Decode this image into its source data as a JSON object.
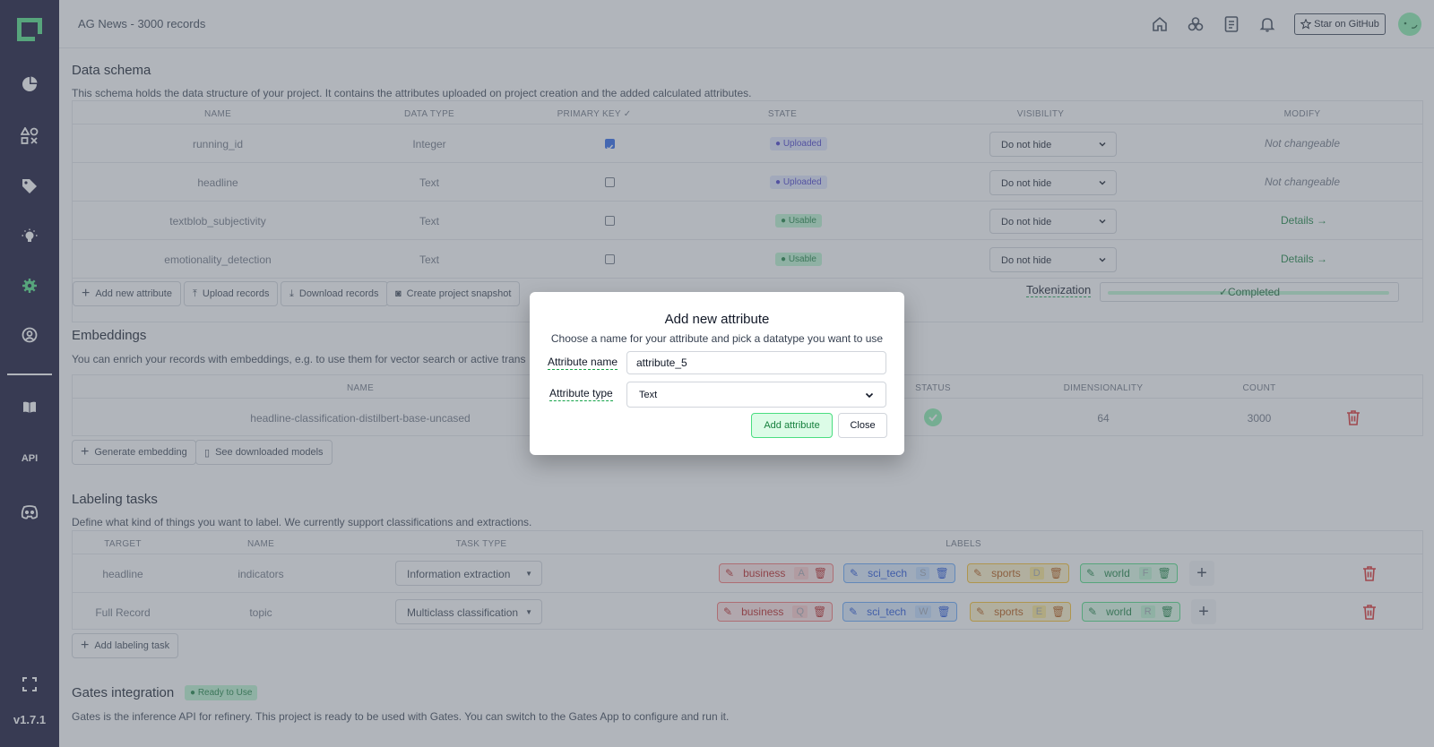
{
  "app": {
    "project_title": "AG News - 3000 records",
    "version": "v1.7.1",
    "github_label": "Star on GitHub",
    "accent_color": "#4ade80",
    "sidebar_bg": "#0c0a2e"
  },
  "sidebar": {
    "items": [
      {
        "icon": "overview-pie-icon"
      },
      {
        "icon": "data-browser-icon"
      },
      {
        "icon": "labeling-tag-icon"
      },
      {
        "icon": "heuristics-bulb-icon"
      },
      {
        "icon": "settings-gear-icon"
      },
      {
        "icon": "user-circle-icon"
      },
      {
        "icon": "docs-book-icon"
      },
      {
        "icon": "api-icon",
        "label": "API"
      },
      {
        "icon": "discord-icon"
      },
      {
        "icon": "fullscreen-icon"
      }
    ]
  },
  "topbar": {
    "icons": [
      "home-icon",
      "community-icon",
      "docs-icon",
      "bell-icon"
    ]
  },
  "data_schema": {
    "title": "Data schema",
    "description": "This schema holds the data structure of your project. It contains the attributes uploaded on project creation and the added calculated attributes.",
    "headers": {
      "name": "NAME",
      "data_type": "DATA TYPE",
      "primary_key": "PRIMARY KEY ✓",
      "state": "STATE",
      "visibility": "VISIBILITY",
      "modify": "MODIFY"
    },
    "rows": [
      {
        "name": "running_id",
        "data_type": "Integer",
        "primary_key": true,
        "state": "Uploaded",
        "visibility": "Do not hide",
        "modify": "Not changeable"
      },
      {
        "name": "headline",
        "data_type": "Text",
        "primary_key": false,
        "state": "Uploaded",
        "visibility": "Do not hide",
        "modify": "Not changeable"
      },
      {
        "name": "textblob_subjectivity",
        "data_type": "Text",
        "primary_key": false,
        "state": "Usable",
        "visibility": "Do not hide",
        "modify": "Details"
      },
      {
        "name": "emotionality_detection",
        "data_type": "Text",
        "primary_key": false,
        "state": "Usable",
        "visibility": "Do not hide",
        "modify": "Details"
      }
    ],
    "buttons": {
      "add_attribute": "Add new attribute",
      "upload": "Upload records",
      "download": "Download records",
      "snapshot": "Create project snapshot"
    },
    "tokenization_label": "Tokenization",
    "tokenization_status": "Completed",
    "tokenization_progress": 1.0
  },
  "embeddings": {
    "title": "Embeddings",
    "description": "You can enrich your records with embeddings, e.g. to use them for vector search or active trans",
    "headers": {
      "name": "NAME",
      "status": "STATUS",
      "dimensionality": "DIMENSIONALITY",
      "count": "COUNT"
    },
    "rows": [
      {
        "name": "headline-classification-distilbert-base-uncased",
        "status": "done",
        "dimensionality": "64",
        "count": "3000"
      }
    ],
    "buttons": {
      "generate": "Generate embedding",
      "see_models": "See downloaded models"
    }
  },
  "labeling_tasks": {
    "title": "Labeling tasks",
    "description": "Define what kind of things you want to label. We currently support classifications and extractions.",
    "headers": {
      "target": "TARGET",
      "name": "NAME",
      "task_type": "TASK TYPE",
      "labels": "LABELS"
    },
    "rows": [
      {
        "target": "headline",
        "name": "indicators",
        "task_type": "Information extraction",
        "labels": [
          {
            "name": "business",
            "key": "A",
            "color": "red"
          },
          {
            "name": "sci_tech",
            "key": "S",
            "color": "blue"
          },
          {
            "name": "sports",
            "key": "D",
            "color": "yellow"
          },
          {
            "name": "world",
            "key": "F",
            "color": "green"
          }
        ]
      },
      {
        "target": "Full Record",
        "name": "topic",
        "task_type": "Multiclass classification",
        "labels": [
          {
            "name": "business",
            "key": "Q",
            "color": "red"
          },
          {
            "name": "sci_tech",
            "key": "W",
            "color": "blue"
          },
          {
            "name": "sports",
            "key": "E",
            "color": "yellow"
          },
          {
            "name": "world",
            "key": "R",
            "color": "green"
          }
        ]
      }
    ],
    "add_button": "Add labeling task"
  },
  "gates": {
    "title": "Gates integration",
    "badge": "Ready to Use",
    "description": "Gates is the inference API for refinery. This project is ready to be used with Gates. You can switch to the Gates App to configure and run it."
  },
  "modal": {
    "title": "Add new attribute",
    "description": "Choose a name for your attribute and pick a datatype you want to use",
    "name_label": "Attribute name",
    "name_value": "attribute_5",
    "type_label": "Attribute type",
    "type_value": "Text",
    "add_button": "Add attribute",
    "close_button": "Close"
  }
}
